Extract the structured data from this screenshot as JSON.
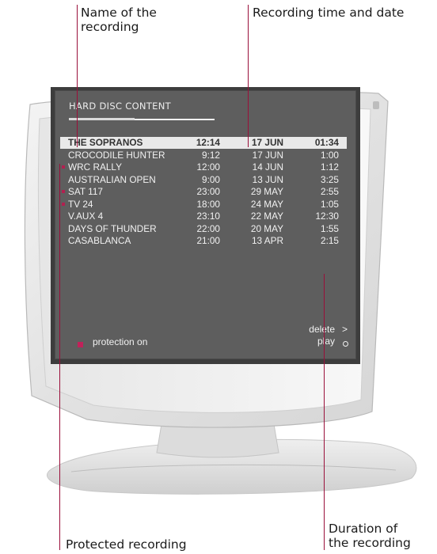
{
  "callouts": {
    "name": "Name of the\nrecording",
    "name_l1": "Name of the",
    "name_l2": "recording",
    "time_date": "Recording time and date",
    "protected": "Protected recording",
    "duration_l1": "Duration of",
    "duration_l2": "the recording"
  },
  "osd": {
    "title": "HARD DISC CONTENT",
    "recordings": [
      {
        "name": "THE  SOPRANOS",
        "time": "12:14",
        "date": "17  JUN",
        "duration": "01:34",
        "protected": false,
        "selected": true
      },
      {
        "name": "CROCODILE  HUNTER",
        "time": "9:12",
        "date": "17  JUN",
        "duration": "1:00",
        "protected": false,
        "selected": false
      },
      {
        "name": "WRC  RALLY",
        "time": "12:00",
        "date": "14  JUN",
        "duration": "1:12",
        "protected": true,
        "selected": false
      },
      {
        "name": "AUSTRALIAN  OPEN",
        "time": "9:00",
        "date": "13  JUN",
        "duration": "3:25",
        "protected": false,
        "selected": false
      },
      {
        "name": "SAT  117",
        "time": "23:00",
        "date": "29  MAY",
        "duration": "2:55",
        "protected": true,
        "selected": false
      },
      {
        "name": "TV  24",
        "time": "18:00",
        "date": "24  MAY",
        "duration": "1:05",
        "protected": true,
        "selected": false
      },
      {
        "name": "V.AUX  4",
        "time": "23:10",
        "date": "22 MAY",
        "duration": "12:30",
        "protected": false,
        "selected": false
      },
      {
        "name": "DAYS  OF  THUNDER",
        "time": "22:00",
        "date": "20  MAY",
        "duration": "1:55",
        "protected": false,
        "selected": false
      },
      {
        "name": "CASABLANCA",
        "time": "21:00",
        "date": "13  APR",
        "duration": "2:15",
        "protected": false,
        "selected": false
      }
    ],
    "legend": "protection on",
    "delete_label": "delete",
    "delete_symbol": ">",
    "play_label": "play"
  },
  "colors": {
    "osd_background": "#5e5e5e",
    "osd_text": "#f1f1f1",
    "selection_bar": "#e9e9e9",
    "protection_marker": "#b22050",
    "callout_line": "#9a0f3a"
  }
}
